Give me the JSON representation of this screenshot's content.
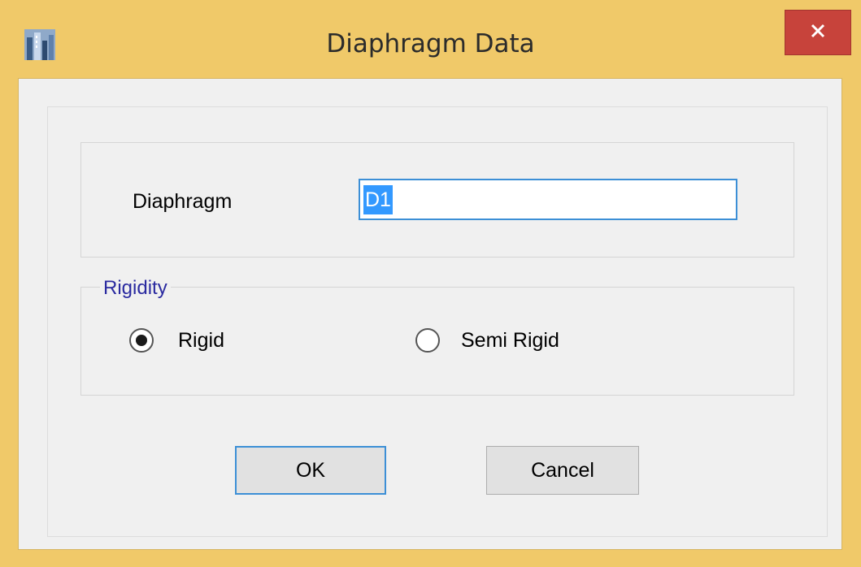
{
  "window": {
    "title": "Diaphragm Data",
    "icon": "app-buildings-icon",
    "close": "close-icon",
    "colors": {
      "frame": "#f0c969",
      "close_button": "#c7433b",
      "client": "#f0f0f0",
      "focus_border": "#3c8fd6",
      "selection": "#3399ff",
      "group_legend": "#2a2aa0"
    }
  },
  "form": {
    "diaphragm_label": "Diaphragm",
    "diaphragm_value": "D1"
  },
  "rigidity": {
    "legend": "Rigidity",
    "options": [
      {
        "label": "Rigid",
        "checked": true
      },
      {
        "label": "Semi Rigid",
        "checked": false
      }
    ]
  },
  "buttons": {
    "ok": "OK",
    "cancel": "Cancel"
  }
}
